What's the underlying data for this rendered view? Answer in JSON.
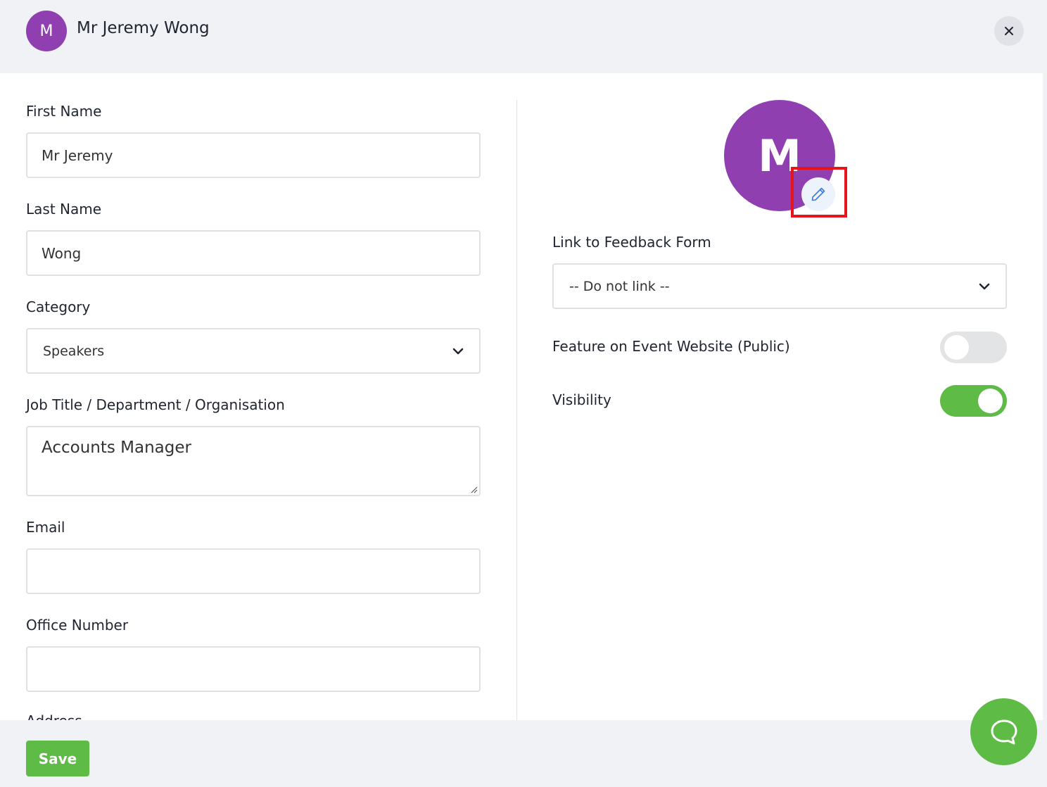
{
  "header": {
    "avatar_initial": "M",
    "title": "Mr Jeremy Wong",
    "avatar_color": "#8f3fb0"
  },
  "form": {
    "first_name_label": "First Name",
    "first_name_value": "Mr Jeremy",
    "last_name_label": "Last Name",
    "last_name_value": "Wong",
    "category_label": "Category",
    "category_value": "Speakers",
    "job_title_label": "Job Title / Department / Organisation",
    "job_title_value": "Accounts Manager",
    "email_label": "Email",
    "email_value": "",
    "office_number_label": "Office Number",
    "office_number_value": "",
    "address_label": "Address"
  },
  "right": {
    "avatar_initial": "M",
    "feedback_label": "Link to Feedback Form",
    "feedback_value": "-- Do not link --",
    "feature_label": "Feature on Event Website (Public)",
    "feature_on": false,
    "visibility_label": "Visibility",
    "visibility_on": true
  },
  "footer": {
    "save_label": "Save"
  },
  "colors": {
    "accent_green": "#5dbb46",
    "avatar_purple": "#8f3fb0",
    "highlight_red": "#e8141b"
  },
  "icons": [
    "close-icon",
    "chevron-down-icon",
    "pencil-icon",
    "resize-handle-icon",
    "chat-bubble-icon"
  ]
}
